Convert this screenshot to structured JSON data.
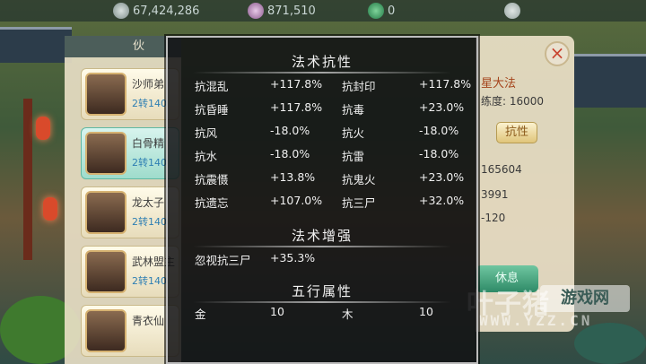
{
  "topbar": {
    "res1_value": "67,424,286",
    "res2_value": "871,510",
    "res3_value": "0"
  },
  "left_panel": {
    "title": "伙",
    "members": [
      {
        "name": "沙师弟",
        "sub": "2转140"
      },
      {
        "name": "白骨精",
        "sub": "2转140"
      },
      {
        "name": "龙太子",
        "sub": "2转140"
      },
      {
        "name": "武林盟主",
        "sub": "2转140"
      },
      {
        "name": "青衣仙",
        "sub": ""
      }
    ]
  },
  "right_panel": {
    "skill_name": "星大法",
    "proficiency": "练度: 16000",
    "resist_button": "抗性",
    "stat1": "165604",
    "stat2": "3991",
    "stat3": "-120",
    "rest_button": "休息"
  },
  "popup": {
    "resist_title": "法术抗性",
    "resist_rows": [
      {
        "l_name": "抗混乱",
        "l_val": "+117.8%",
        "r_name": "抗封印",
        "r_val": "+117.8%"
      },
      {
        "l_name": "抗昏睡",
        "l_val": "+117.8%",
        "r_name": "抗毒",
        "r_val": "+23.0%"
      },
      {
        "l_name": "抗风",
        "l_val": "-18.0%",
        "r_name": "抗火",
        "r_val": "-18.0%"
      },
      {
        "l_name": "抗水",
        "l_val": "-18.0%",
        "r_name": "抗雷",
        "r_val": "-18.0%"
      },
      {
        "l_name": "抗震慑",
        "l_val": "+13.8%",
        "r_name": "抗鬼火",
        "r_val": "+23.0%"
      },
      {
        "l_name": "抗遗忘",
        "l_val": "+107.0%",
        "r_name": "抗三尸",
        "r_val": "+32.0%"
      }
    ],
    "boost_title": "法术增强",
    "boost_rows": [
      {
        "name": "忽视抗三尸",
        "val": "+35.3%"
      }
    ],
    "element_title": "五行属性",
    "element_rows": [
      {
        "l_name": "金",
        "l_val": "10",
        "r_name": "木",
        "r_val": "10"
      }
    ]
  },
  "watermark": {
    "brand": "叶子猪",
    "badge": "游戏网",
    "url": "WWW.YZZ.CN"
  }
}
